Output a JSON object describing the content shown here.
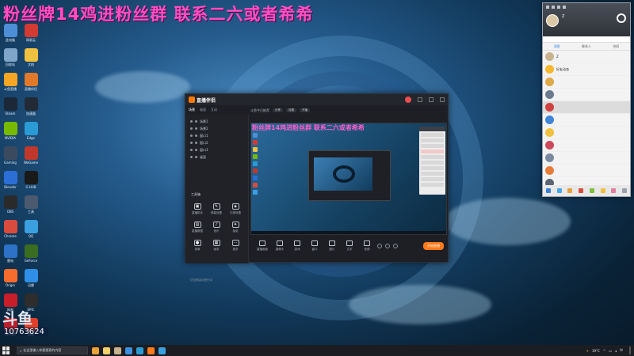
{
  "overlay_headline": "粉丝牌14鸡进粉丝群 联系二六或者希希",
  "desktop_icons": [
    {
      "label": "此电脑",
      "icon": "computer-icon",
      "color": "#4d8fd6"
    },
    {
      "label": "网易云",
      "icon": "netease-icon",
      "color": "#d33a31"
    },
    {
      "label": "回收站",
      "icon": "recycle-bin-icon",
      "color": "#7fa6c9"
    },
    {
      "label": "文档",
      "icon": "document-icon",
      "color": "#f0c040"
    },
    {
      "label": "斗鱼直播",
      "icon": "owl-icon",
      "color": "#f5a623"
    },
    {
      "label": "直播伴侣",
      "icon": "bear-icon",
      "color": "#e07a2a"
    },
    {
      "label": "Steam",
      "icon": "steam-icon",
      "color": "#1b2838"
    },
    {
      "label": "加速器",
      "icon": "speed-icon",
      "color": "#222a36"
    },
    {
      "label": "NVIDIA",
      "icon": "nvidia-icon",
      "color": "#76b900"
    },
    {
      "label": "Edge",
      "icon": "edge-icon",
      "color": "#2b9bd6"
    },
    {
      "label": "Gaming",
      "icon": "controller-icon",
      "color": "#3c4a60"
    },
    {
      "label": "WeGame",
      "icon": "wegame-icon",
      "color": "#c0382b"
    },
    {
      "label": "Blender",
      "icon": "blender-icon",
      "color": "#2b6fd6"
    },
    {
      "label": "G HUB",
      "icon": "logitech-icon",
      "color": "#1a1a1a"
    },
    {
      "label": "OBS",
      "icon": "obs-icon",
      "color": "#2a2a2a"
    },
    {
      "label": "工具",
      "icon": "tool-icon",
      "color": "#4b5a6e"
    },
    {
      "label": "Chrome",
      "icon": "chrome-icon",
      "color": "#d94c3d"
    },
    {
      "label": "QQ",
      "icon": "qq-icon",
      "color": "#3aa0e0"
    },
    {
      "label": "雷电",
      "icon": "thunder-icon",
      "color": "#2c73c7"
    },
    {
      "label": "GeForce",
      "icon": "geforce-icon",
      "color": "#3a6d22"
    },
    {
      "label": "Origin",
      "icon": "origin-icon",
      "color": "#f56c2d"
    },
    {
      "label": "迅雷",
      "icon": "xunlei-icon",
      "color": "#2f8fe6"
    },
    {
      "label": "网易",
      "icon": "netease-game-icon",
      "color": "#c81e2a"
    },
    {
      "label": "EPIC",
      "icon": "epic-icon",
      "color": "#2d2d2d"
    },
    {
      "label": "Ubisoft",
      "icon": "ubisoft-icon",
      "color": "#b8212b"
    },
    {
      "label": "游戏",
      "icon": "game-icon",
      "color": "#e0402b"
    }
  ],
  "douyu": {
    "logo": "斗鱼",
    "room": "10763624"
  },
  "app": {
    "name": "直播伴侣",
    "tabs": [
      "场景",
      "画面",
      "互动"
    ],
    "scenes": [
      "场景1",
      "场景2",
      "窗口1",
      "窗口2",
      "窗口3",
      "桌面"
    ],
    "tools_title": "工具箱",
    "tools": [
      {
        "label": "直播助手",
        "glyph": "▣"
      },
      {
        "label": "弹幕设置",
        "glyph": "✎"
      },
      {
        "label": "礼物设置",
        "glyph": "◈"
      },
      {
        "label": "直播数据",
        "glyph": "▤"
      },
      {
        "label": "音乐",
        "glyph": "♪"
      },
      {
        "label": "抽奖",
        "glyph": "✦"
      },
      {
        "label": "录像",
        "glyph": "●"
      },
      {
        "label": "画质",
        "glyph": "▦"
      },
      {
        "label": "更多",
        "glyph": "⋯"
      }
    ],
    "side_footer": "红包雨活动进行中",
    "preview_row1": "斗鱼今日推荐",
    "preview_chips": [
      "分享",
      "设置",
      "开播"
    ],
    "preview_title": "粉丝牌14鸡进粉丝群 联系二六或者希希",
    "bottom_tools": [
      "直播画面",
      "摄像头",
      "游戏",
      "窗口",
      "图片",
      "文字",
      "音频"
    ],
    "live_button": "开始直播",
    "footer_left": "",
    "footer_right": ""
  },
  "qq": {
    "nickname": "Z",
    "signature": "",
    "tabs": [
      "消息",
      "联系人",
      "空间"
    ],
    "conversations": [
      {
        "name": "Z",
        "msg": "",
        "color": "#c9b38f"
      },
      {
        "name": "好友动态",
        "msg": "",
        "color": "#f5b82e"
      },
      {
        "name": "",
        "msg": "",
        "color": "#e0a94a"
      },
      {
        "name": "",
        "msg": "",
        "color": "#6b7a8f"
      },
      {
        "name": "",
        "msg": "",
        "color": "#d04040",
        "selected": true
      },
      {
        "name": "",
        "msg": "",
        "color": "#3f84d8"
      },
      {
        "name": "",
        "msg": "",
        "color": "#f0c040"
      },
      {
        "name": "",
        "msg": "",
        "color": "#cc4a5c"
      },
      {
        "name": "",
        "msg": "",
        "color": "#7a8aa0"
      },
      {
        "name": "",
        "msg": "",
        "color": "#e77c3a"
      },
      {
        "name": "",
        "msg": "",
        "color": "#5b6473"
      }
    ]
  },
  "taskbar": {
    "search_placeholder": "在这里输入你要搜索的内容",
    "weather": "19°C",
    "ime": "中",
    "time": "",
    "date": ""
  }
}
